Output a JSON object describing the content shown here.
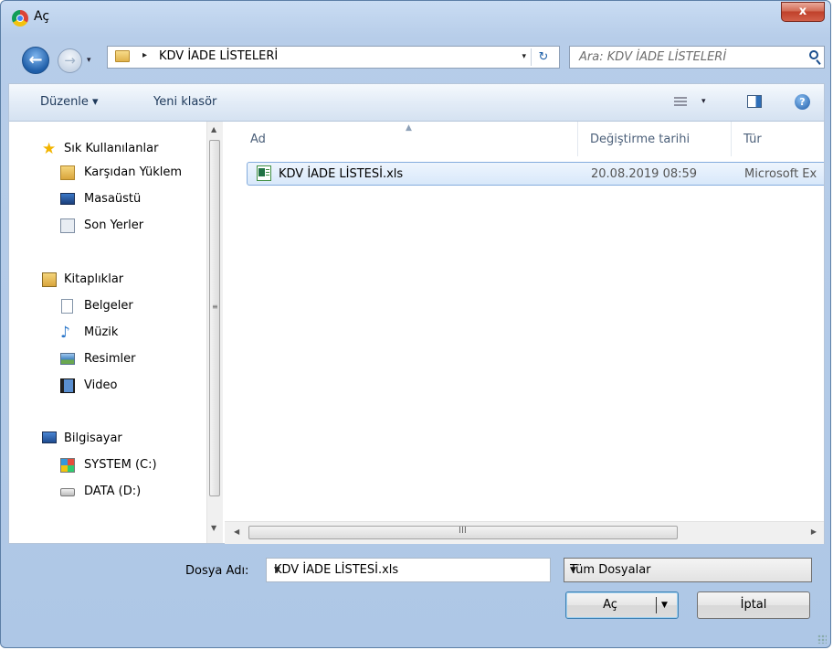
{
  "window": {
    "title": "Aç",
    "close_glyph": "x"
  },
  "nav_buttons": {
    "back_glyph": "←",
    "forward_glyph": "→",
    "history_glyph": "▾"
  },
  "address": {
    "separator": "▸",
    "path": "KDV İADE LİSTELERİ",
    "dropdown_glyph": "▾",
    "refresh_glyph": "↻"
  },
  "search": {
    "placeholder": "Ara: KDV İADE LİSTELERİ"
  },
  "toolbar": {
    "organize_label": "Düzenle ▾",
    "new_folder_label": "Yeni klasör",
    "view_arrow": "▾",
    "help_glyph": "?"
  },
  "nav": {
    "favorites": {
      "label": "Sık Kullanılanlar",
      "items": [
        "Karşıdan Yüklem",
        "Masaüstü",
        "Son Yerler"
      ]
    },
    "libraries": {
      "label": "Kitaplıklar",
      "items": [
        "Belgeler",
        "Müzik",
        "Resimler",
        "Video"
      ]
    },
    "computer": {
      "label": "Bilgisayar",
      "items": [
        "SYSTEM (C:)",
        "DATA (D:)"
      ]
    }
  },
  "columns": {
    "name": "Ad",
    "modified": "Değiştirme tarihi",
    "type": "Tür"
  },
  "files": [
    {
      "name": "KDV İADE LİSTESİ.xls",
      "modified": "20.08.2019 08:59",
      "type": "Microsoft Ex"
    }
  ],
  "scroll": {
    "up": "▲",
    "down": "▼",
    "left": "◀",
    "right": "▶",
    "v_grip": "≡",
    "h_grip": "III"
  },
  "bottom": {
    "filename_label": "Dosya Adı:",
    "filename_value": "KDV İADE LİSTESİ.xls",
    "filetype_value": "Tüm Dosyalar",
    "dropdown_glyph": "▼",
    "open_label": "Aç",
    "cancel_label": "İptal"
  }
}
